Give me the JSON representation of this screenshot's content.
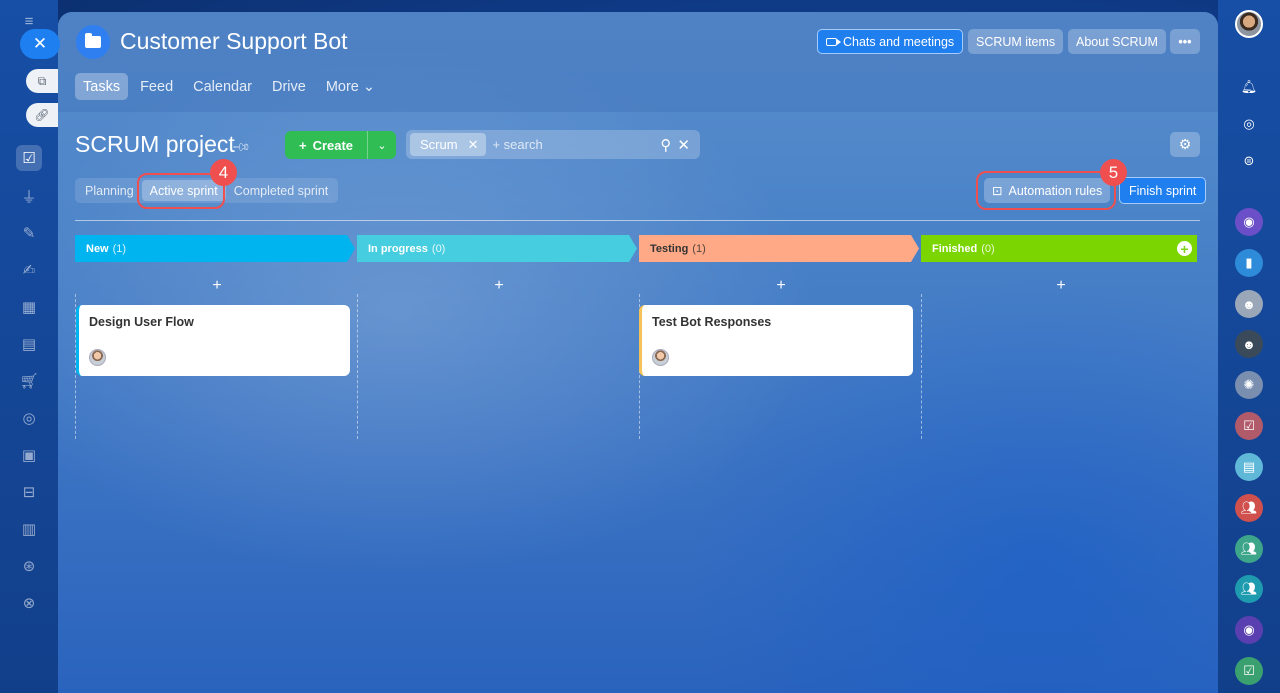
{
  "app": {
    "title": "Customer Support Bot",
    "header_buttons": {
      "chats": "Chats and meetings",
      "scrum_items": "SCRUM items",
      "about": "About SCRUM",
      "more": "•••"
    },
    "nav_tabs": [
      "Tasks",
      "Feed",
      "Calendar",
      "Drive",
      "More ⌄"
    ],
    "active_nav_tab": "Tasks"
  },
  "project": {
    "title": "SCRUM project",
    "create_label": "Create",
    "search": {
      "chip": "Scrum",
      "placeholder": "+ search"
    },
    "sprint_tabs": [
      "Planning",
      "Active sprint",
      "Completed sprint"
    ],
    "active_sprint_tab": "Active sprint",
    "automation_label": "Automation rules",
    "finish_label": "Finish sprint"
  },
  "callouts": {
    "sprint_badge": "4",
    "automation_badge": "5"
  },
  "board": {
    "columns": [
      {
        "name": "New",
        "count": "(1)",
        "color": "#00b4f0"
      },
      {
        "name": "In progress",
        "count": "(0)",
        "color": "#47cde0"
      },
      {
        "name": "Testing",
        "count": "(1)",
        "color": "#ffa986"
      },
      {
        "name": "Finished",
        "count": "(0)",
        "color": "#7bd500"
      }
    ],
    "add_symbol": "+",
    "cards": [
      {
        "title": "Design User Flow",
        "column": "New",
        "accent": "#00b4f0"
      },
      {
        "title": "Test Bot Responses",
        "column": "Testing",
        "accent": "#f5c25a"
      }
    ]
  },
  "colors": {
    "primary_button": "#1f7fef",
    "create_button": "#2fbd54",
    "callout": "#ef4f4f"
  }
}
